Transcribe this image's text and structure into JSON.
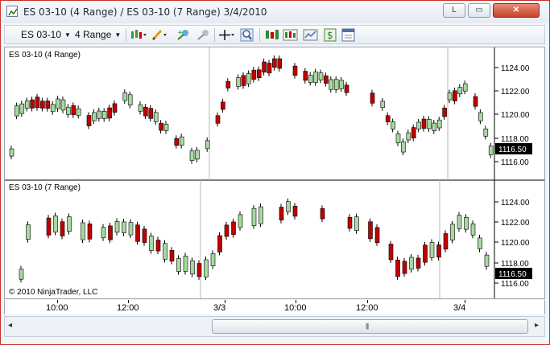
{
  "window": {
    "title": "ES 03-10 (4 Range) / ES 03-10 (7 Range)  3/4/2010",
    "minimize_glyph": "L",
    "maximize_glyph": "▭",
    "close_glyph": "✕"
  },
  "toolbar": {
    "instrument": "ES 03-10",
    "interval": "4 Range",
    "icons": [
      "chart-style-icon",
      "pencil-draw-icon",
      "add-indicator-icon",
      "strategy-icon",
      "crosshair-icon",
      "zoom-icon",
      "bar-colors-icon",
      "chart-trader-icon",
      "data-box-icon",
      "dollar-icon",
      "properties-icon"
    ]
  },
  "colors": {
    "up": "#a7d9a0",
    "down": "#c00000",
    "wick": "#000000",
    "accent": "#c9302c"
  },
  "panels": {
    "top": {
      "label": "ES 03-10 (4 Range)",
      "price_ticks": [
        "1124.00",
        "1122.00",
        "1120.00",
        "1118.00",
        "1116.00"
      ],
      "last_price": "1116.50"
    },
    "bottom": {
      "label": "ES 03-10 (7 Range)",
      "price_ticks": [
        "1124.00",
        "1122.00",
        "1120.00",
        "1118.00",
        "1116.00"
      ],
      "last_price": "1116.50",
      "copyright": "© 2010 NinjaTrader, LLC"
    }
  },
  "time_axis": [
    "10:00",
    "12:00",
    "3/3",
    "10:00",
    "12:00",
    "3/4"
  ],
  "scrollbar": {
    "left_arrow": "◂",
    "right_arrow": "▸",
    "grip": "|||"
  }
}
